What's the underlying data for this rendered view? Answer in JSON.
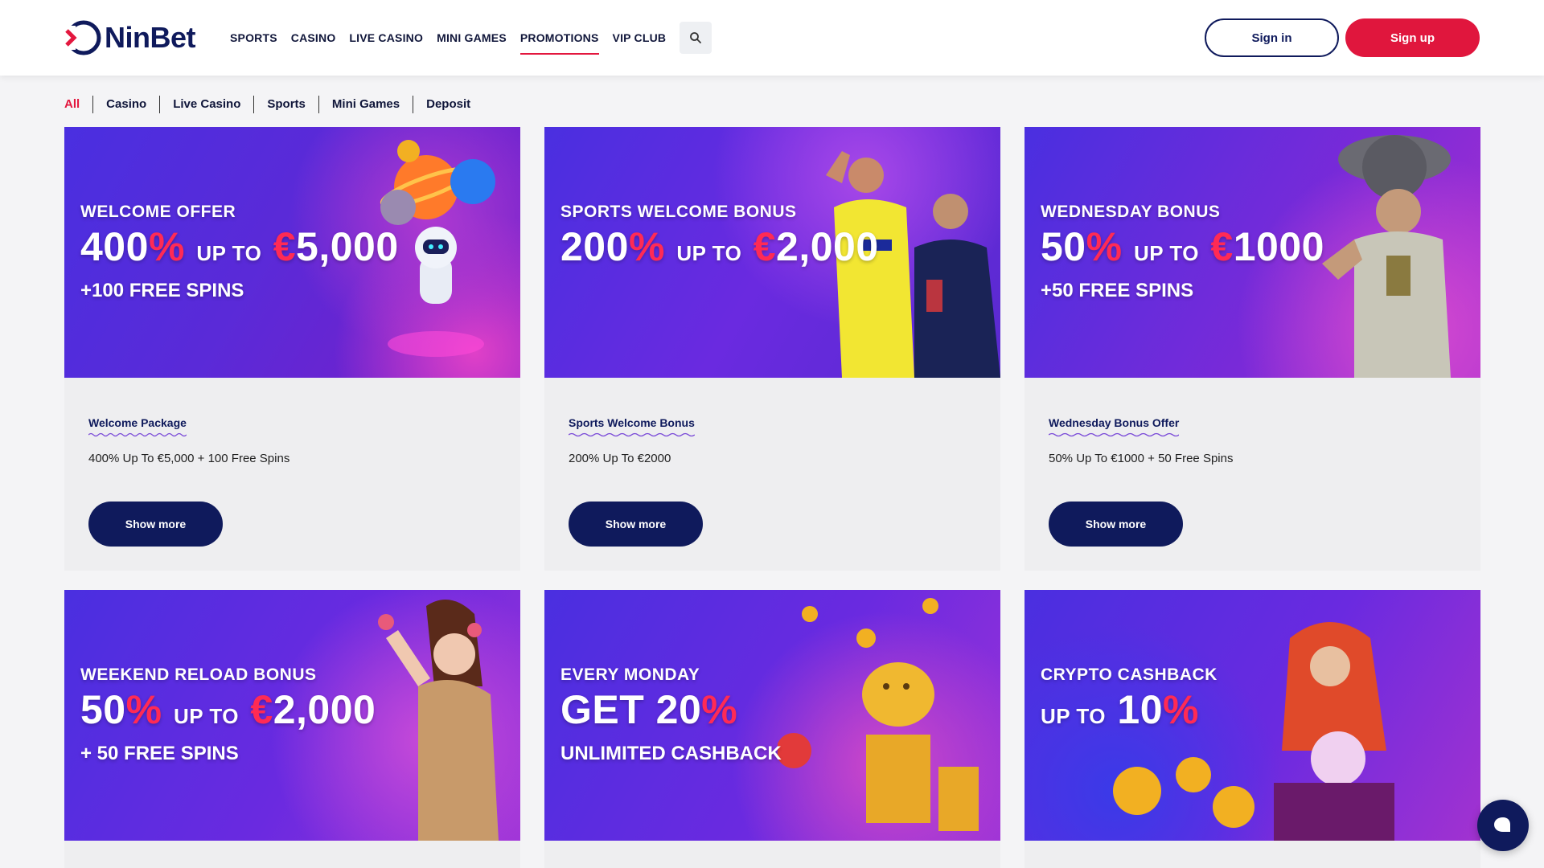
{
  "brand": {
    "name": "NinBet",
    "accent": "#e3173e",
    "navy": "#0f1a5c"
  },
  "nav": {
    "items": [
      "SPORTS",
      "CASINO",
      "LIVE CASINO",
      "MINI GAMES",
      "PROMOTIONS",
      "VIP CLUB"
    ],
    "active": "PROMOTIONS"
  },
  "auth": {
    "signin": "Sign in",
    "signup": "Sign up"
  },
  "filters": [
    "All",
    "Casino",
    "Live Casino",
    "Sports",
    "Mini Games",
    "Deposit"
  ],
  "promotions": [
    {
      "banner": {
        "line1": "WELCOME OFFER",
        "pct": "400",
        "pct_sign": "%",
        "upto": "UP TO",
        "currency": "€",
        "amount": "5,000",
        "line3": "+100 FREE SPINS"
      },
      "title": "Welcome Package",
      "desc": "400% Up To €5,000 + 100 Free Spins",
      "button": "Show more"
    },
    {
      "banner": {
        "line1": "SPORTS WELCOME BONUS",
        "pct": "200",
        "pct_sign": "%",
        "upto": "UP TO",
        "currency": "€",
        "amount": "2,000"
      },
      "title": "Sports Welcome Bonus",
      "desc": "200% Up To €2000",
      "button": "Show more"
    },
    {
      "banner": {
        "line1": "WEDNESDAY BONUS",
        "pct": "50",
        "pct_sign": "%",
        "upto": "UP TO",
        "currency": "€",
        "amount": "1000",
        "line3": "+50 FREE SPINS"
      },
      "title": "Wednesday Bonus Offer",
      "desc": "50% Up To €1000 + 50 Free Spins",
      "button": "Show more"
    },
    {
      "banner": {
        "line1": "WEEKEND RELOAD BONUS",
        "pct": "50",
        "pct_sign": "%",
        "upto": "UP TO",
        "currency": "€",
        "amount": "2,000",
        "line3": "+ 50 FREE SPINS"
      }
    },
    {
      "banner": {
        "line1": "EVERY MONDAY",
        "big": "GET 20",
        "pct_sign": "%",
        "line3": "UNLIMITED CASHBACK"
      }
    },
    {
      "banner": {
        "line1": "CRYPTO CASHBACK",
        "upto": "UP TO",
        "pct": "10",
        "pct_sign": "%"
      }
    }
  ]
}
